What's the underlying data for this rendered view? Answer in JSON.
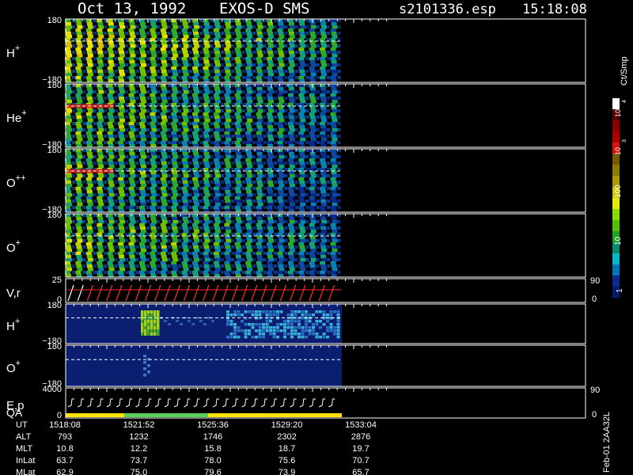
{
  "header": {
    "date": "Oct 13, 1992",
    "instrument": "EXOS-D SMS",
    "file": "s2101336.esp",
    "time": "15:18:08"
  },
  "chart_data": {
    "type": "heatmap",
    "panels": [
      {
        "label": "H",
        "sup": "+",
        "y_top": "180",
        "y_bottom": "−180",
        "kind": "stripes",
        "intensity": 0.75
      },
      {
        "label": "He",
        "sup": "+",
        "y_top": "180",
        "y_bottom": "−180",
        "kind": "stripes",
        "intensity": 0.6
      },
      {
        "label": "O",
        "sup": "++",
        "y_top": "180",
        "y_bottom": "−180",
        "kind": "stripes",
        "intensity": 0.55
      },
      {
        "label": "O",
        "sup": "+",
        "y_top": "180",
        "y_bottom": "",
        "kind": "stripes",
        "intensity": 0.6
      },
      {
        "label": "V,r",
        "sup": "",
        "y_top": "25",
        "y_bottom": "0",
        "right_top": "90",
        "right_bottom": "0",
        "kind": "line"
      },
      {
        "label": "H",
        "sup": "+",
        "y_top": "180",
        "y_bottom": "−180",
        "kind": "blocks"
      },
      {
        "label": "O",
        "sup": "+",
        "y_top": "180",
        "y_bottom": "−180",
        "kind": "sparse"
      },
      {
        "label": "E,p",
        "label2": "QA",
        "sup": "",
        "y_top": "4000",
        "y_bottom": "0",
        "right_top": "90",
        "right_bottom": "0",
        "kind": "energy"
      }
    ],
    "colorbar": {
      "unit": "Ct/Smp",
      "tick_labels": [
        "10",
        "4",
        "10",
        "3",
        "100",
        "10",
        "1"
      ],
      "colors": [
        "#ffffff",
        "#5a0000",
        "#8b0000",
        "#b00000",
        "#dd1010",
        "#7a5a00",
        "#8f7a00",
        "#aa9900",
        "#cccc00",
        "#e8e800",
        "#88dd00",
        "#55c000",
        "#1aa81a",
        "#009070",
        "#00b8c8",
        "#0077bb",
        "#0a2a90",
        "#051a6a"
      ]
    },
    "time_axis": {
      "rows": [
        {
          "label": "UT",
          "values": [
            "1518:08",
            "1521:52",
            "1525:36",
            "1529:20",
            "1533:04"
          ]
        },
        {
          "label": "ALT",
          "values": [
            "793",
            "1232",
            "1746",
            "2302",
            "2876"
          ]
        },
        {
          "label": "MLT",
          "values": [
            "10.8",
            "12.2",
            "15.8",
            "18.7",
            "19.7"
          ]
        },
        {
          "label": "InLat",
          "values": [
            "63.7",
            "73.7",
            "78.0",
            "75.6",
            "70.7"
          ]
        },
        {
          "label": "MLat",
          "values": [
            "62.9",
            "75.0",
            "79.6",
            "73.9",
            "65.7"
          ]
        }
      ]
    }
  },
  "footer_stamp": "Feb-01 2AA32L"
}
